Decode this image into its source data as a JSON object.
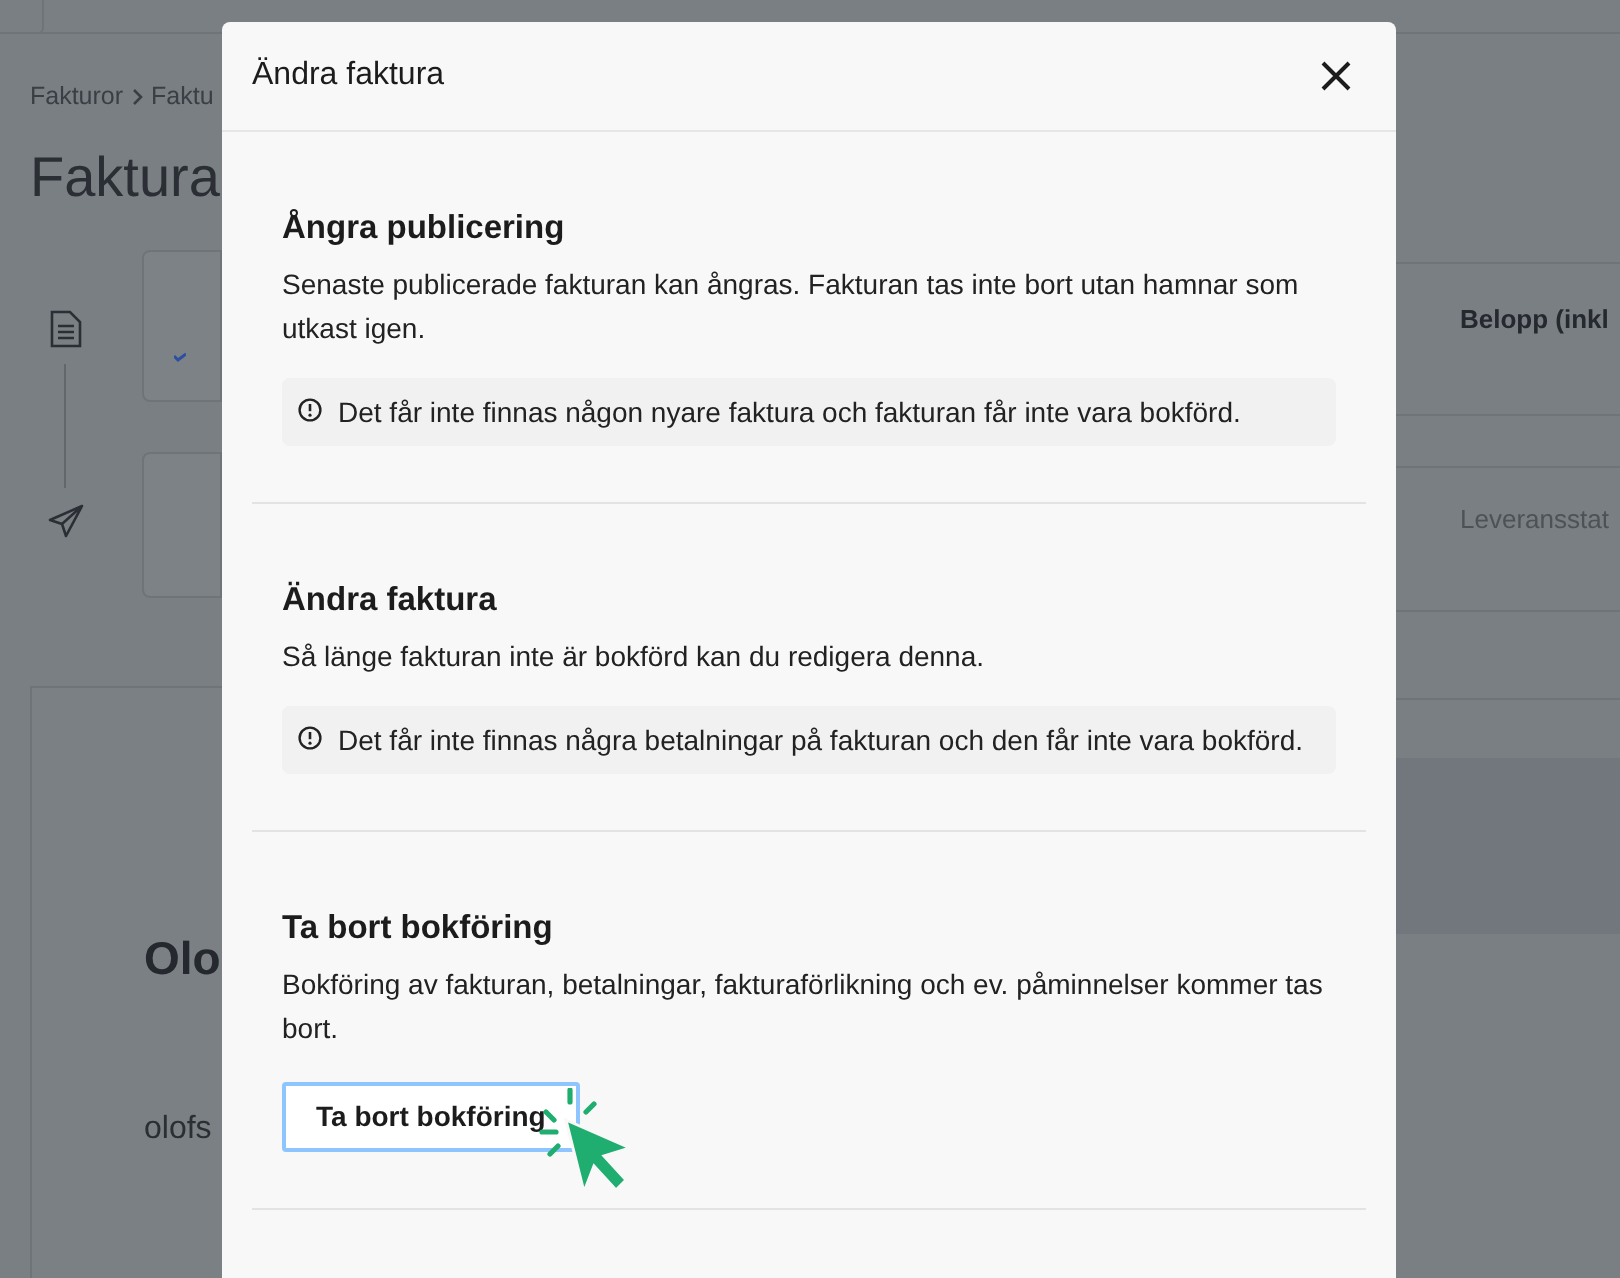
{
  "background": {
    "breadcrumb": [
      "Fakturor",
      "Faktu"
    ],
    "title": "Faktura",
    "cards": [
      {
        "label": "Belopp (inkl",
        "kind": "heading"
      },
      {
        "label": "Leveransstat",
        "kind": "muted"
      }
    ],
    "customer": {
      "name": "Olo",
      "email": "olofs"
    }
  },
  "dialog": {
    "title": "Ändra faktura",
    "sections": [
      {
        "heading": "Ångra publicering",
        "text": "Senaste publicerade fakturan kan ångras. Fakturan tas inte bort utan hamnar som utkast igen.",
        "note": "Det får inte finnas någon nyare faktura och fakturan får inte vara bokförd."
      },
      {
        "heading": "Ändra faktura",
        "text": "Så länge fakturan inte är bokförd kan du redigera denna.",
        "note": "Det får inte finnas några betalningar på fakturan och den får inte vara bokförd."
      },
      {
        "heading": "Ta bort bokföring",
        "text": "Bokföring av fakturan, betalningar, fakturaförlikning och ev. påminnelser kommer tas bort.",
        "button": "Ta bort bokföring"
      }
    ]
  }
}
